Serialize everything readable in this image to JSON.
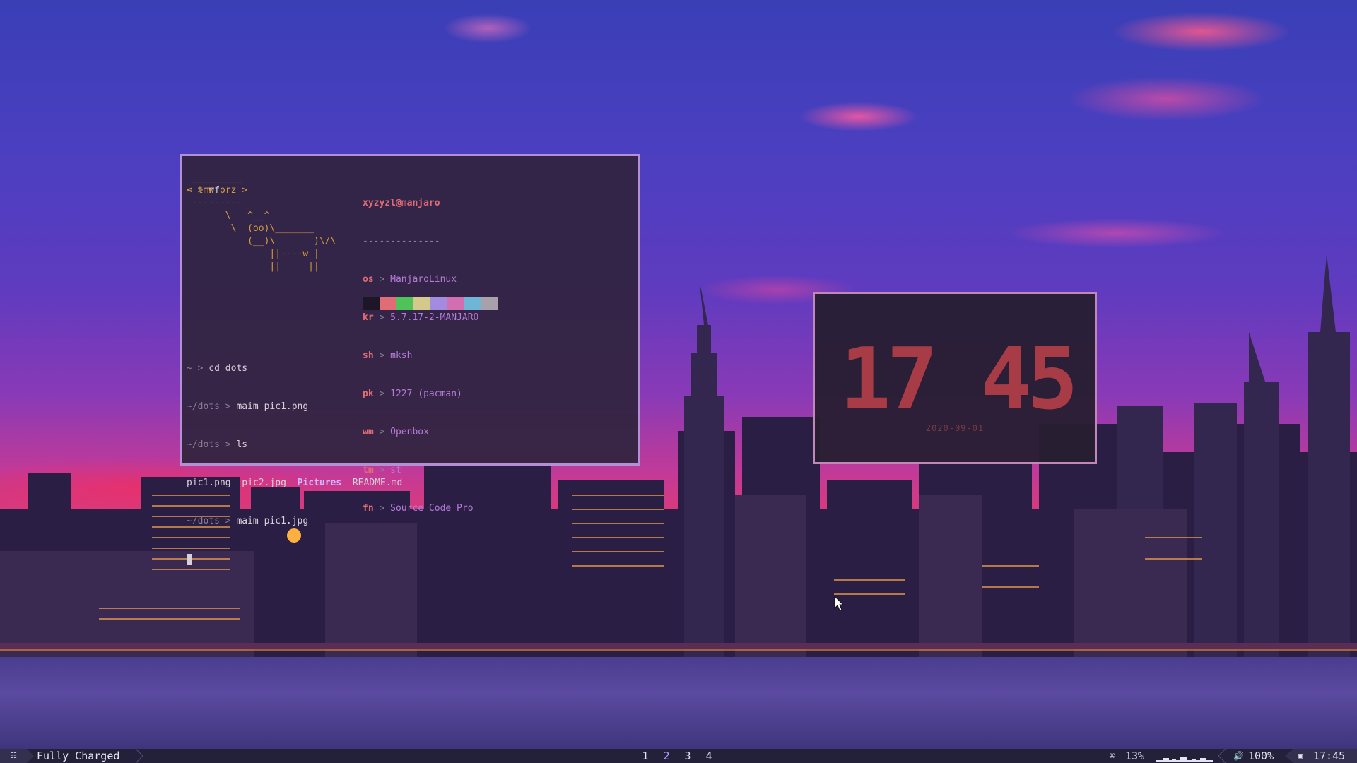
{
  "terminal": {
    "lines": [
      {
        "prompt": "~ >",
        "cmd": " nf"
      }
    ],
    "cow": {
      "line1": " _________",
      "line2": "< tmw orz >",
      "line3": " ---------",
      "line4": "       \\   ^__^",
      "line5": "        \\  (oo)\\_______",
      "line6": "           (__)\\       )\\/\\",
      "line7": "               ||----w |",
      "line8": "               ||     ||"
    },
    "info": {
      "title": "xyzyzl@manjaro",
      "underline": "--------------",
      "rows": [
        {
          "key": "os",
          "sep": " > ",
          "val": "ManjaroLinux"
        },
        {
          "key": "kr",
          "sep": " > ",
          "val": "5.7.17-2-MANJARO"
        },
        {
          "key": "sh",
          "sep": " > ",
          "val": "mksh"
        },
        {
          "key": "pk",
          "sep": " > ",
          "val": "1227 (pacman)"
        },
        {
          "key": "wm",
          "sep": " > ",
          "val": "Openbox"
        },
        {
          "key": "tm",
          "sep": " > ",
          "val": "st"
        },
        {
          "key": "fn",
          "sep": " > ",
          "val": "Source Code Pro"
        }
      ],
      "palette": [
        "#1c1626",
        "#e06c75",
        "#4fc25a",
        "#d4c98a",
        "#a38be0",
        "#d36fb0",
        "#6fb6d6",
        "#a8a0aa"
      ]
    },
    "history": [
      {
        "prompt": "~ >",
        "cmd": " cd dots"
      },
      {
        "prompt": "~/dots >",
        "cmd": " maim pic1.png"
      },
      {
        "prompt": "~/dots >",
        "cmd": " ls"
      },
      {
        "prompt": "~/dots >",
        "cmd": " maim pic1.jpg"
      }
    ],
    "ls_output": {
      "file1": "pic1.png",
      "file2": "pic2.jpg",
      "dir": "Pictures",
      "file3": "README.md"
    }
  },
  "clock": {
    "time": "17 45",
    "date": "2020-09-01",
    "digit_color": "#a83c46"
  },
  "taskbar": {
    "menu_icon": "grid-icon",
    "battery": "Fully Charged",
    "workspaces": [
      "1",
      "2",
      "3",
      "4"
    ],
    "active_workspace": "2",
    "cpu": "13%",
    "volume": "100%",
    "time": "17:45"
  }
}
